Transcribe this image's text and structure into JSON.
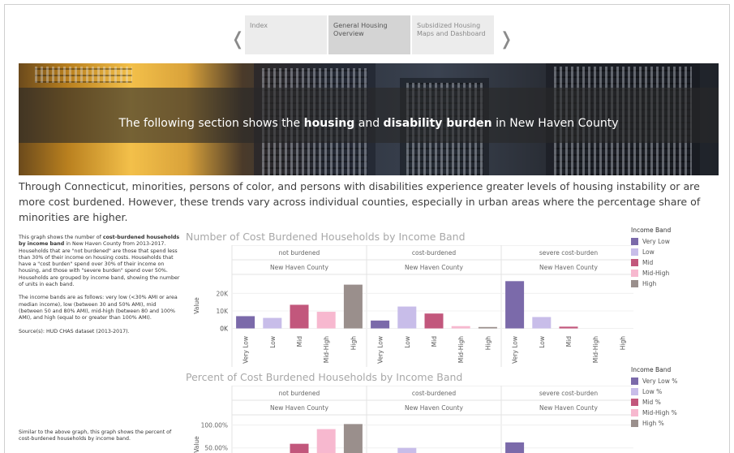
{
  "nav": {
    "tabs": [
      {
        "label": "Index",
        "active": false
      },
      {
        "label": "General Housing Overview",
        "active": true
      },
      {
        "label": "Subsidized Housing Maps and Dashboard",
        "active": false
      }
    ],
    "prev_icon": "chevron-left-icon",
    "next_icon": "chevron-right-icon"
  },
  "banner": {
    "pre": "The following section shows the ",
    "b1": "housing",
    "mid": " and ",
    "b2": "disability burden",
    "post": " in New Haven County"
  },
  "intro": "Through Connecticut, minorities, persons of color, and persons with disabilities experience greater levels of housing instability or are more cost burdened. However, these trends vary across individual counties, especially in urban areas where the percentage share of minorities are higher.",
  "note1": {
    "p1_a": "This graph shows the number of ",
    "p1_b": "cost-burdened households by income band",
    "p1_c": " in New Haven County from 2013-2017. Households that are \"not burdened\" are those that spend less than 30% of their income on housing costs. Households that have a \"cost burden\" spend over 30% of their income on housing, and those with \"severe burden\" spend over 50%. Households are grouped by income band, showing the number of units in each band.",
    "p2": "The income bands are as follows: very low (<30% AMI or area median income), low (between 30 and 50% AMI), mid (between 50 and 80% AMI), mid-high (between 80 and 100% AMI), and high (equal to or greater than 100% AMI).",
    "p3": "Source(s): HUD CHAS dataset (2013-2017)."
  },
  "note2": "Similar to the above graph, this graph shows the percent of cost-burdened households by income band.",
  "colors": {
    "very_low": "#7b6aaa",
    "low": "#c8bde9",
    "mid": "#c2577c",
    "mid_high": "#f7b8cf",
    "high": "#9a8f8c"
  },
  "legend1": {
    "title": "Income Band",
    "items": [
      "Very Low",
      "Low",
      "Mid",
      "Mid-High",
      "High"
    ]
  },
  "legend2": {
    "title": "Income Band",
    "items": [
      "Very Low %",
      "Low %",
      "Mid %",
      "Mid-High %",
      "High %"
    ]
  },
  "chart_data": [
    {
      "type": "bar",
      "title": "Number of Cost Burdened Households by Income Band",
      "ylabel": "Value",
      "categories": [
        "Very Low",
        "Low",
        "Mid",
        "Mid-High",
        "High"
      ],
      "panels": [
        {
          "name": "not burdened",
          "sub": "New Haven County",
          "values": [
            7000,
            6000,
            13500,
            9500,
            25000
          ]
        },
        {
          "name": "cost-burdened",
          "sub": "New Haven County",
          "values": [
            4500,
            12500,
            8500,
            1300,
            800
          ]
        },
        {
          "name": "severe cost-burden",
          "sub": "New Haven County",
          "values": [
            27000,
            6500,
            1000,
            0,
            0
          ]
        }
      ],
      "yticks": [
        0,
        10000,
        20000
      ],
      "ytick_labels": [
        "0K",
        "10K",
        "20K"
      ],
      "ylim": [
        -3000,
        29000
      ]
    },
    {
      "type": "bar",
      "title": "Percent of Cost Burdened Households by Income Band",
      "ylabel": "Value",
      "categories": [
        "Very Low %",
        "Low %",
        "Mid %",
        "Mid-High %",
        "High %"
      ],
      "panels": [
        {
          "name": "not burdened",
          "sub": "New Haven County",
          "values": [
            0,
            0,
            0.59,
            0.91,
            1.02
          ]
        },
        {
          "name": "cost-burdened",
          "sub": "New Haven County",
          "values": [
            0,
            0.5,
            0.38,
            0,
            0
          ]
        },
        {
          "name": "severe cost-burden",
          "sub": "New Haven County",
          "values": [
            0.62,
            0,
            0,
            0,
            0
          ]
        }
      ],
      "yticks": [
        0.5,
        1.0
      ],
      "ytick_labels": [
        "50.00%",
        "100.00%"
      ],
      "ylim": [
        0,
        1.15
      ]
    }
  ]
}
